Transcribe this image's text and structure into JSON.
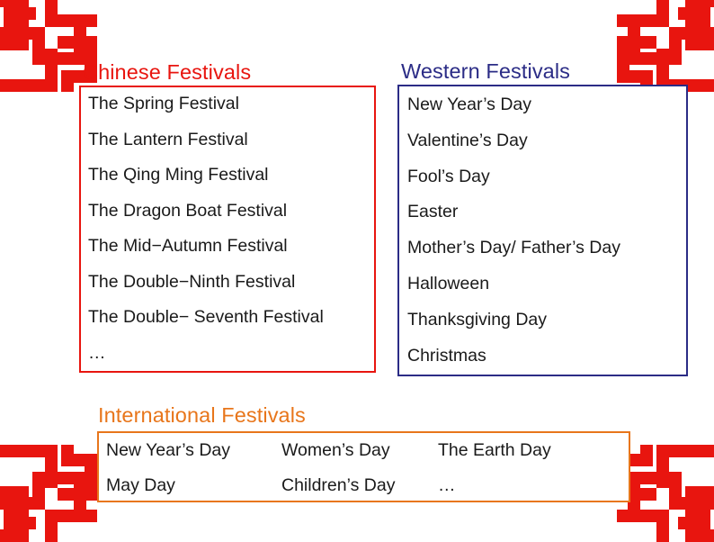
{
  "slide": {
    "background_color": "#ffffff",
    "ornament": {
      "name": "chinese-endless-knot",
      "color": "#E8150F",
      "corners": [
        "top-left",
        "top-right",
        "bottom-left",
        "bottom-right"
      ]
    }
  },
  "sections": {
    "chinese": {
      "heading": "Chinese Festivals",
      "heading_color": "#E8150F",
      "border_color": "#E8150F",
      "items": [
        "The Spring Festival",
        "The Lantern Festival",
        "The Qing Ming Festival",
        "The Dragon Boat Festival",
        "The Mid−Autumn Festival",
        "The Double−Ninth Festival",
        "The Double− Seventh Festival",
        "…"
      ]
    },
    "western": {
      "heading": "Western Festivals",
      "heading_color": "#2B2C86",
      "border_color": "#2B2C86",
      "items": [
        "New Year’s Day",
        "Valentine’s Day",
        "Fool’s Day",
        "Easter",
        "Mother’s Day/ Father’s Day",
        "Halloween",
        "Thanksgiving Day",
        "Christmas"
      ]
    },
    "international": {
      "heading": "International Festivals",
      "heading_color": "#E8761B",
      "border_color": "#E8761B",
      "rows": [
        [
          "New Year’s Day",
          "Women’s Day",
          "The Earth Day"
        ],
        [
          "May Day",
          "Children’s Day",
          "…"
        ]
      ]
    }
  }
}
